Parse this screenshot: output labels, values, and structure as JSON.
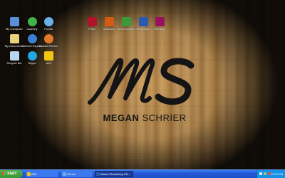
{
  "desktop_icons": [
    {
      "label": "My Computer",
      "icon": "computer-icon",
      "color": "#5a8fd6"
    },
    {
      "label": "Launchy",
      "icon": "launchy-icon",
      "color": "#3fb24a"
    },
    {
      "label": "iTunes",
      "icon": "itunes-icon",
      "color": "#6ab0e8"
    },
    {
      "label": "My Documents",
      "icon": "documents-icon",
      "color": "#e7d27a"
    },
    {
      "label": "Internet Explorer",
      "icon": "internet-explorer-icon",
      "color": "#3a7fd1"
    },
    {
      "label": "Mozilla Firefox",
      "icon": "firefox-icon",
      "color": "#e07a2a"
    },
    {
      "label": "Recycle Bin",
      "icon": "recycle-bin-icon",
      "color": "#bcd6f0"
    },
    {
      "label": "Skype",
      "icon": "skype-icon",
      "color": "#24a6e0"
    },
    {
      "label": "AIM",
      "icon": "aim-running-man-icon",
      "color": "#f1c40f"
    }
  ],
  "app_shortcuts": [
    {
      "label": "Flash",
      "icon": "flash-icon",
      "color": "#b0142a"
    },
    {
      "label": "Illustrator",
      "icon": "illustrator-icon",
      "color": "#d45a10"
    },
    {
      "label": "Dreamweaver",
      "icon": "dreamweaver-icon",
      "color": "#3a9a3a"
    },
    {
      "label": "Photoshop",
      "icon": "photoshop-icon",
      "color": "#2a5ab0"
    },
    {
      "label": "InDesign",
      "icon": "indesign-icon",
      "color": "#9a1060"
    }
  ],
  "wallpaper": {
    "monogram": "MS",
    "name_first": "MEGAN",
    "name_last": "SCHRIER"
  },
  "taskbar": {
    "start_label": "start",
    "tasks": [
      {
        "label": "AIM",
        "icon": "aim-icon",
        "color": "#f1c40f"
      },
      {
        "label": "iTunes",
        "icon": "itunes-icon",
        "color": "#6ab0e8"
      },
      {
        "label": "Adobe Photoshop CS...",
        "icon": "photoshop-icon",
        "color": "#2a5ab0"
      }
    ],
    "tray_icons": [
      "volume-icon",
      "network-icon",
      "security-icon"
    ],
    "clock": "12:09 PM"
  },
  "colors": {
    "taskbar_blue": "#2458d4",
    "start_green": "#3a9434",
    "tray_blue": "#1692e4"
  }
}
